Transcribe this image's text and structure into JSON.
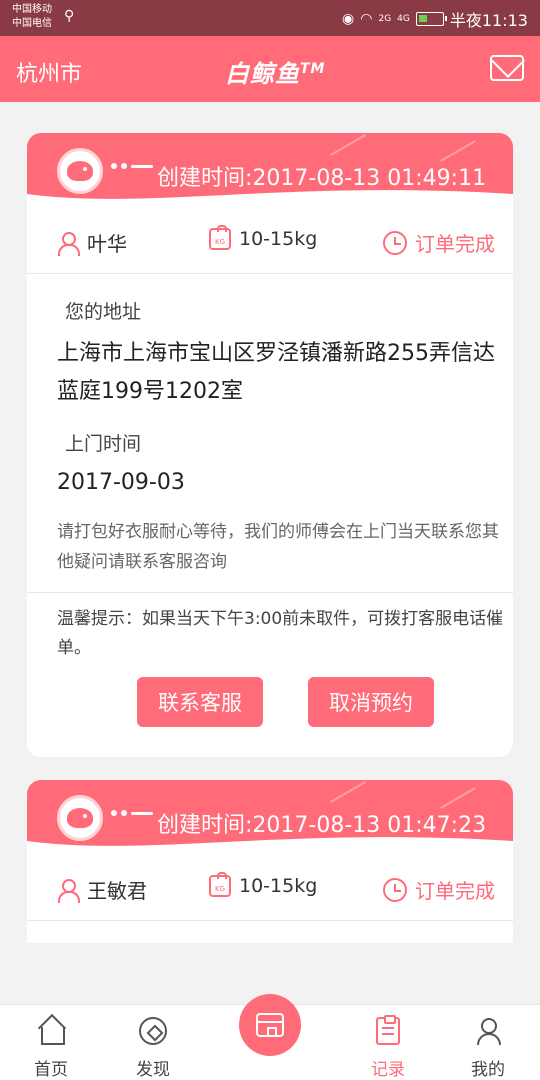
{
  "status_bar": {
    "carrier_1": "中国移动",
    "carrier_2": "中国电信",
    "signal_1": "2G",
    "signal_2": "4G",
    "time": "半夜11:13"
  },
  "header": {
    "city": "杭州市",
    "brand": "白鲸鱼",
    "brand_mark": "TM"
  },
  "orders": [
    {
      "created_label": "创建时间:",
      "created_time": "2017-08-13 01:49:11",
      "user": "叶华",
      "weight_badge": "KG",
      "weight": "10-15kg",
      "status": "订单完成",
      "address_label": "您的地址",
      "address": "上海市上海市宝山区罗泾镇潘新路255弄信达蓝庭199号1202室",
      "visit_label": "上门时间",
      "visit_date": "2017-09-03",
      "note": "请打包好衣服耐心等待，我们的师傅会在上门当天联系您其他疑问请联系客服咨询",
      "tip": "温馨提示：如果当天下午3:00前未取件，可拨打客服电话催单。",
      "contact_btn": "联系客服",
      "cancel_btn": "取消预约"
    },
    {
      "created_label": "创建时间:",
      "created_time": "2017-08-13 01:47:23",
      "user": "王敏君",
      "weight_badge": "KG",
      "weight": "10-15kg",
      "status": "订单完成"
    }
  ],
  "nav": {
    "home": "首页",
    "discover": "发现",
    "records": "记录",
    "mine": "我的"
  },
  "colors": {
    "accent": "#ff6b78",
    "status_bar": "#8a3a44"
  }
}
